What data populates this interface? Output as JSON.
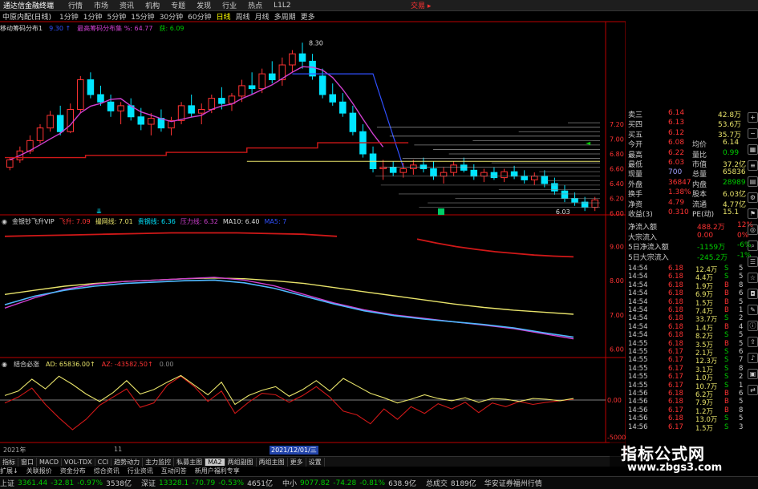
{
  "title_bar": {
    "app": "通达信金融终端",
    "menus": [
      "行情",
      "市场",
      "资讯",
      "机构",
      "专题",
      "发现",
      "行业",
      "热点",
      "L1L2"
    ],
    "trade": "交易 ▸"
  },
  "period_bar": {
    "stock": "中原内配(日线)",
    "periods": [
      "1分钟",
      "1分钟",
      "5分钟",
      "15分钟",
      "30分钟",
      "60分钟",
      "日线",
      "周线",
      "月线",
      "多周期",
      "更多"
    ],
    "active": "日线"
  },
  "legend_main": {
    "name": "移动筹码分布1",
    "item1": "9.30  ↑",
    "item2": "最高筹码分布集 %: 64.77",
    "item3": "获: 6.09"
  },
  "legend_sub1": {
    "name": "金银钞飞升VIP",
    "items": [
      "飞升: 7.09",
      "撮网线: 7.01",
      "贵钢线: 6.36",
      "压力线: 6.32",
      "MA10: 6.40",
      "MA5: 7"
    ]
  },
  "legend_sub2": {
    "name": "结合必涨",
    "items": [
      "AD: 65836.00↑",
      "AZ: -43582.50↑",
      "0.00"
    ]
  },
  "main_labels": {
    "high": "8.30",
    "low": "6.03"
  },
  "date_labels": {
    "left": "2021年",
    "mid": "11",
    "sel": "2021/12/01/三"
  },
  "price_axis": [
    "7.20",
    "7.00",
    "6.80",
    "6.60",
    "6.40",
    "6.20",
    "6.00"
  ],
  "sub1_axis": [
    "9.00",
    "8.00",
    "7.00",
    "6.00"
  ],
  "sub2_axis": [
    "0.00",
    "-5000"
  ],
  "quote": {
    "rows": [
      {
        "label": "卖三",
        "price": "6.14",
        "vol": "42.8万"
      },
      {
        "label": "买四",
        "price": "6.13",
        "vol": "53.6万"
      },
      {
        "label": "买五",
        "price": "6.12",
        "vol": "35.7万"
      },
      {
        "label": "今开",
        "price": "6.08",
        "label2": "均价",
        "val2": "6.14"
      },
      {
        "label": "最高",
        "price": "6.22",
        "label2": "量比",
        "val2": "0.99"
      },
      {
        "label": "最低",
        "price": "6.03",
        "label2": "市值",
        "val2": "37.2亿"
      },
      {
        "label": "现量",
        "price": "700",
        "label2": "总量",
        "val2": "65836"
      },
      {
        "label": "外盘",
        "price": "36847",
        "label2": "内盘",
        "val2": "28989"
      },
      {
        "label": "换手",
        "price": "1.38%",
        "label2": "股本",
        "val2": "6.03亿"
      },
      {
        "label": "净资",
        "price": "4.79",
        "label2": "流通",
        "val2": "4.77亿"
      },
      {
        "label": "收益(3)",
        "price": "0.310",
        "label2": "PE(动)",
        "val2": "15.1"
      }
    ]
  },
  "flow": {
    "rows": [
      {
        "label": "净流入额",
        "val": "488.2万",
        "pct": "12%"
      },
      {
        "label": "大宗流入",
        "val": "0.00",
        "pct": "0%"
      },
      {
        "label": "5日净流入额",
        "val": "-1159万",
        "pct": "-6%"
      },
      {
        "label": "5日大宗流入",
        "val": "-245.2万",
        "pct": "-1%"
      }
    ]
  },
  "ticks": [
    {
      "t": "14:54",
      "p": "6.18",
      "v": "12.4万",
      "s": "S",
      "n": "5"
    },
    {
      "t": "14:54",
      "p": "6.18",
      "v": "4.4万",
      "s": "S",
      "n": "5"
    },
    {
      "t": "14:54",
      "p": "6.18",
      "v": "1.9万",
      "s": "B",
      "n": "8"
    },
    {
      "t": "14:54",
      "p": "6.18",
      "v": "6.9万",
      "s": "B",
      "n": "6"
    },
    {
      "t": "14:54",
      "p": "6.18",
      "v": "1.5万",
      "s": "B",
      "n": "5"
    },
    {
      "t": "14:54",
      "p": "6.18",
      "v": "7.4万",
      "s": "B",
      "n": "1"
    },
    {
      "t": "14:54",
      "p": "6.18",
      "v": "33.7万",
      "s": "S",
      "n": "2"
    },
    {
      "t": "14:54",
      "p": "6.18",
      "v": "1.4万",
      "s": "B",
      "n": "4"
    },
    {
      "t": "14:54",
      "p": "6.18",
      "v": "8.2万",
      "s": "S",
      "n": "5"
    },
    {
      "t": "14:55",
      "p": "6.18",
      "v": "3.5万",
      "s": "B",
      "n": "5"
    },
    {
      "t": "14:55",
      "p": "6.17",
      "v": "2.1万",
      "s": "S",
      "n": "6"
    },
    {
      "t": "14:55",
      "p": "6.17",
      "v": "12.3万",
      "s": "S",
      "n": "7"
    },
    {
      "t": "14:55",
      "p": "6.17",
      "v": "3.1万",
      "s": "S",
      "n": "8"
    },
    {
      "t": "14:55",
      "p": "6.17",
      "v": "1.0万",
      "s": "S",
      "n": "2"
    },
    {
      "t": "14:55",
      "p": "6.17",
      "v": "10.7万",
      "s": "S",
      "n": "1"
    },
    {
      "t": "14:56",
      "p": "6.18",
      "v": "6.2万",
      "s": "B",
      "n": "6"
    },
    {
      "t": "14:56",
      "p": "6.18",
      "v": "7.9万",
      "s": "B",
      "n": "5"
    },
    {
      "t": "14:56",
      "p": "6.17",
      "v": "1.2万",
      "s": "B",
      "n": "8"
    },
    {
      "t": "14:56",
      "p": "6.18",
      "v": "13.0万",
      "s": "S",
      "n": "5"
    },
    {
      "t": "14:56",
      "p": "6.17",
      "v": "1.5万",
      "s": "S",
      "n": "3"
    }
  ],
  "bottom_tabs": [
    "指标",
    "窗口",
    "MACD",
    "VOL-TDX",
    "CCI",
    "趋势动力",
    "主力监控",
    "私募主图",
    "MA2",
    "两组副图",
    "两组主图",
    "更多",
    "设置"
  ],
  "bottom_tabs_active": "MA2",
  "tabs2": [
    "扩展↓",
    "关联报价",
    "资金分布",
    "综合资讯",
    "行业资讯",
    "互动问答",
    "新用户福利专享"
  ],
  "status": {
    "sh_label": "上证",
    "sh_val": "3361.44",
    "sh_chg": "-32.81",
    "sh_pct": "-0.97%",
    "sh_amt": "3538亿",
    "sz_label": "深证",
    "sz_val": "13328.1",
    "sz_chg": "-70.79",
    "sz_pct": "-0.53%",
    "sz_amt": "4651亿",
    "zx_label": "中小",
    "zx_val": "9077.82",
    "zx_chg": "-74.28",
    "zx_pct": "-0.81%",
    "zx_amt": "638.9亿",
    "total_label": "总成交",
    "total_val": "8189亿",
    "broker": "华安证券福州行情"
  },
  "watermark": {
    "line1": "指标公式网",
    "line2": "www.zbgs3.com"
  },
  "colors": {
    "up": "#ff3333",
    "down": "#00e5ff",
    "yellow": "#e8e36a",
    "magenta": "#d040d0",
    "red": "#d01818",
    "blue": "#3050ff",
    "green": "#00cc00"
  },
  "chart_data": {
    "type": "candlestick",
    "candles": [
      [
        6.62,
        6.75,
        6.58,
        6.72
      ],
      [
        6.72,
        6.9,
        6.68,
        6.84
      ],
      [
        6.84,
        7.05,
        6.8,
        6.98
      ],
      [
        6.98,
        7.2,
        6.94,
        7.15
      ],
      [
        7.15,
        7.38,
        7.1,
        7.32
      ],
      [
        7.32,
        7.45,
        7.05,
        7.1
      ],
      [
        7.1,
        7.48,
        7.08,
        7.4
      ],
      [
        7.4,
        7.85,
        7.35,
        7.8
      ],
      [
        7.8,
        7.9,
        7.55,
        7.6
      ],
      [
        7.6,
        7.72,
        7.45,
        7.5
      ],
      [
        7.5,
        7.6,
        7.3,
        7.38
      ],
      [
        7.38,
        7.5,
        7.2,
        7.45
      ],
      [
        7.45,
        7.55,
        7.25,
        7.3
      ],
      [
        7.3,
        7.42,
        7.12,
        7.2
      ],
      [
        7.2,
        7.35,
        7.05,
        7.28
      ],
      [
        7.28,
        7.4,
        7.1,
        7.15
      ],
      [
        7.15,
        7.3,
        7.05,
        7.25
      ],
      [
        7.25,
        7.5,
        7.2,
        7.45
      ],
      [
        7.45,
        7.6,
        7.3,
        7.35
      ],
      [
        7.35,
        7.48,
        7.2,
        7.4
      ],
      [
        7.4,
        7.6,
        7.35,
        7.55
      ],
      [
        7.55,
        7.7,
        7.4,
        7.48
      ],
      [
        7.48,
        7.62,
        7.38,
        7.58
      ],
      [
        7.58,
        7.8,
        7.5,
        7.72
      ],
      [
        7.72,
        7.9,
        7.6,
        7.68
      ],
      [
        7.68,
        7.95,
        7.62,
        7.88
      ],
      [
        7.88,
        8.05,
        7.75,
        7.8
      ],
      [
        7.8,
        8.1,
        7.72,
        8.0
      ],
      [
        8.0,
        8.2,
        7.9,
        8.15
      ],
      [
        8.15,
        8.3,
        7.95,
        8.05
      ],
      [
        8.05,
        8.15,
        7.8,
        7.85
      ],
      [
        7.85,
        7.95,
        7.55,
        7.6
      ],
      [
        7.6,
        7.75,
        7.45,
        7.5
      ],
      [
        7.5,
        7.62,
        7.3,
        7.35
      ],
      [
        7.35,
        7.45,
        7.05,
        7.1
      ],
      [
        7.1,
        7.2,
        6.75,
        6.8
      ],
      [
        6.8,
        6.9,
        6.55,
        6.6
      ],
      [
        6.6,
        6.72,
        6.45,
        6.62
      ],
      [
        6.62,
        6.7,
        6.5,
        6.55
      ],
      [
        6.55,
        6.68,
        6.48,
        6.6
      ],
      [
        6.6,
        6.72,
        6.52,
        6.65
      ],
      [
        6.65,
        6.75,
        6.55,
        6.6
      ],
      [
        6.6,
        6.7,
        6.45,
        6.5
      ],
      [
        6.5,
        6.62,
        6.4,
        6.55
      ],
      [
        6.55,
        6.7,
        6.5,
        6.65
      ],
      [
        6.65,
        6.75,
        6.55,
        6.58
      ],
      [
        6.58,
        6.66,
        6.45,
        6.5
      ],
      [
        6.5,
        6.6,
        6.42,
        6.55
      ],
      [
        6.55,
        6.62,
        6.45,
        6.48
      ],
      [
        6.48,
        6.6,
        6.42,
        6.56
      ],
      [
        6.56,
        6.64,
        6.46,
        6.5
      ],
      [
        6.5,
        6.58,
        6.4,
        6.45
      ],
      [
        6.45,
        6.55,
        6.38,
        6.5
      ],
      [
        6.5,
        6.58,
        6.35,
        6.4
      ],
      [
        6.4,
        6.48,
        6.25,
        6.3
      ],
      [
        6.3,
        6.38,
        6.15,
        6.2
      ],
      [
        6.2,
        6.28,
        6.1,
        6.15
      ],
      [
        6.15,
        6.22,
        6.03,
        6.08
      ],
      [
        6.08,
        6.22,
        6.03,
        6.18
      ]
    ],
    "price_range": [
      6.0,
      8.4
    ],
    "sub1": {
      "red": [
        9.3,
        9.32,
        9.34,
        9.36,
        9.38,
        9.4,
        9.4,
        9.4,
        9.38,
        9.36,
        9.3,
        9.22,
        9.1,
        9.0,
        8.92,
        8.85,
        8.8,
        8.75,
        8.72,
        8.7
      ],
      "yellow": [
        7.6,
        7.72,
        7.84,
        7.92,
        7.98,
        8.02,
        8.06,
        8.08,
        8.06,
        8.0,
        7.92,
        7.8,
        7.68,
        7.56,
        7.44,
        7.32,
        7.22,
        7.14,
        7.08,
        7.02
      ],
      "magenta": [
        7.2,
        7.5,
        7.75,
        7.9,
        7.98,
        8.02,
        8.06,
        8.1,
        8.02,
        7.85,
        7.6,
        7.35,
        7.15,
        7.0,
        6.9,
        6.8,
        6.7,
        6.6,
        6.45,
        6.3
      ],
      "cyan": [
        7.3,
        7.55,
        7.72,
        7.84,
        7.92,
        7.96,
        8.0,
        8.02,
        7.94,
        7.78,
        7.55,
        7.32,
        7.12,
        6.98,
        6.88,
        6.8,
        6.72,
        6.62,
        6.48,
        6.35
      ],
      "range": [
        5.8,
        9.6
      ]
    },
    "sub2": {
      "ad": [
        600,
        1200,
        2800,
        1500,
        3200,
        2100,
        800,
        -200,
        1000,
        2600,
        800,
        1400,
        2400,
        3300,
        2000,
        700,
        2400,
        -600,
        600,
        1300,
        1800,
        500,
        1400,
        2600,
        1200,
        2900,
        1900,
        900,
        300,
        -400,
        100,
        700,
        200,
        -100,
        300,
        -300,
        200,
        100,
        -200,
        200,
        100,
        -100,
        200
      ],
      "az": [
        -400,
        400,
        1600,
        -600,
        -2400,
        -4000,
        -2600,
        -700,
        400,
        1500,
        -1000,
        -400,
        2000,
        3200,
        1800,
        -200,
        1200,
        -1800,
        -300,
        900,
        700,
        -300,
        600,
        1800,
        400,
        -1500,
        -2000,
        -3200,
        -1200,
        -2600,
        -900,
        -1800,
        -500,
        -1200,
        -300,
        -1700,
        -400,
        -900,
        -200,
        -600,
        -300,
        -100,
        100
      ],
      "range": [
        -5500,
        4200
      ]
    }
  }
}
